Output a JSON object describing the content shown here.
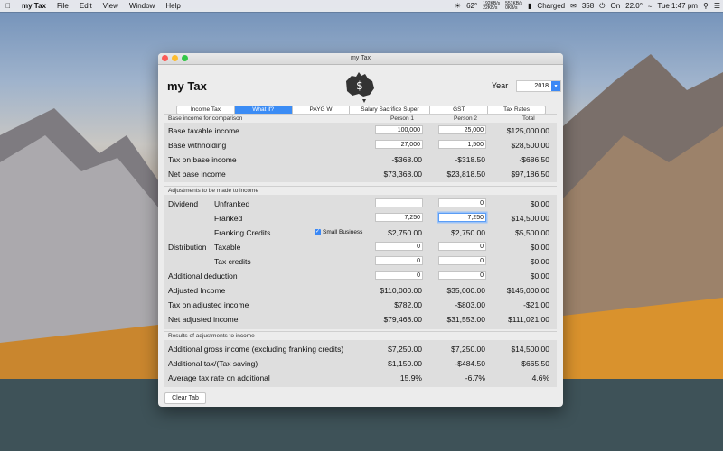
{
  "menubar": {
    "app_name": "my Tax",
    "menus": [
      "File",
      "Edit",
      "View",
      "Window",
      "Help"
    ],
    "status": {
      "temperature": "62°",
      "net_up": "192KB/s",
      "net_down": "22KB/s",
      "disk_read": "551KB/s",
      "disk_write": "0KB/s",
      "battery": "Charged",
      "mail_count": "358",
      "power": "On",
      "weather": "22.0°",
      "clock": "Tue 1:47 pm"
    }
  },
  "window": {
    "title": "my Tax",
    "app_title": "my Tax",
    "year_label": "Year",
    "year_value": "2018",
    "tabs": [
      "Income Tax",
      "What if?",
      "PAYG W",
      "Salary Sacrifice Super",
      "GST",
      "Tax Rates"
    ],
    "active_tab": "What if?",
    "clear_button": "Clear Tab"
  },
  "base": {
    "header": "Base income for comparison",
    "col_person1": "Person 1",
    "col_person2": "Person 2",
    "col_total": "Total",
    "rows": [
      {
        "label": "Base taxable income",
        "p1": "100,000",
        "p2": "25,000",
        "total": "$125,000.00"
      },
      {
        "label": "Base withholding",
        "p1": "27,000",
        "p2": "1,500",
        "total": "$28,500.00"
      },
      {
        "label": "Tax on base income",
        "p1": "-$368.00",
        "p2": "-$318.50",
        "total": "-$686.50"
      },
      {
        "label": "Net base income",
        "p1": "$73,368.00",
        "p2": "$23,818.50",
        "total": "$97,186.50"
      }
    ]
  },
  "adjust": {
    "header": "Adjustments to be made to income",
    "dividend_label": "Dividend",
    "distribution_label": "Distribution",
    "unfranked": {
      "label": "Unfranked",
      "p1": "",
      "p2": "0",
      "total": "$0.00"
    },
    "franked": {
      "label": "Franked",
      "p1": "7,250",
      "p2": "7,250",
      "total": "$14,500.00"
    },
    "franking": {
      "label": "Franking Credits",
      "checkbox": "Small Business",
      "p1": "$2,750.00",
      "p2": "$2,750.00",
      "total": "$5,500.00"
    },
    "taxable": {
      "label": "Taxable",
      "p1": "0",
      "p2": "0",
      "total": "$0.00"
    },
    "taxcredits": {
      "label": "Tax credits",
      "p1": "0",
      "p2": "0",
      "total": "$0.00"
    },
    "additional": {
      "label": "Additional deduction",
      "p1": "0",
      "p2": "0",
      "total": "$0.00"
    },
    "adjusted_income": {
      "label": "Adjusted Income",
      "p1": "$110,000.00",
      "p2": "$35,000.00",
      "total": "$145,000.00"
    },
    "tax_adjusted": {
      "label": "Tax on adjusted income",
      "p1": "$782.00",
      "p2": "-$803.00",
      "total": "-$21.00"
    },
    "net_adjusted": {
      "label": "Net adjusted income",
      "p1": "$79,468.00",
      "p2": "$31,553.00",
      "total": "$111,021.00"
    }
  },
  "results": {
    "header": "Results of adjustments to income",
    "rows": [
      {
        "label": "Additional gross income (excluding franking credits)",
        "p1": "$7,250.00",
        "p2": "$7,250.00",
        "total": "$14,500.00"
      },
      {
        "label": "Additional tax/(Tax saving)",
        "p1": "$1,150.00",
        "p2": "-$484.50",
        "total": "$665.50"
      },
      {
        "label": "Average tax rate on additional",
        "p1": "15.9%",
        "p2": "-6.7%",
        "total": "4.6%"
      }
    ]
  }
}
